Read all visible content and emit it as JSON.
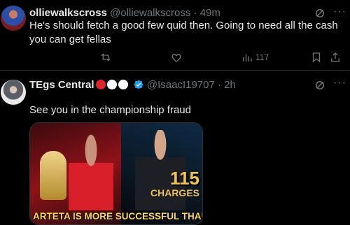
{
  "tweets": [
    {
      "display_name": "olliewalkscross",
      "handle": "@olliewalkscross",
      "separator": "·",
      "time": "49m",
      "text": "He's should fetch a good few quid then. Going to need all the cash you can get fellas",
      "actions": {
        "views": "117"
      }
    },
    {
      "display_name": "TEgs Central",
      "badges": [
        "#e0242c",
        "#ffffff",
        "#ffffff"
      ],
      "handle": "@IsaacI19707",
      "separator": "·",
      "time": "2h",
      "text": "See you in the championship fraud",
      "media": {
        "big_number": "115",
        "charges": "CHARGES",
        "caption": "ARTETA IS MORE SUCCESSFUL THAN PEP?! 😳🏆"
      }
    }
  ],
  "colors": {
    "muted": "#71767b",
    "verified": "#1d9bf0",
    "text": "#e7e9ea",
    "divider": "#2f3336"
  }
}
